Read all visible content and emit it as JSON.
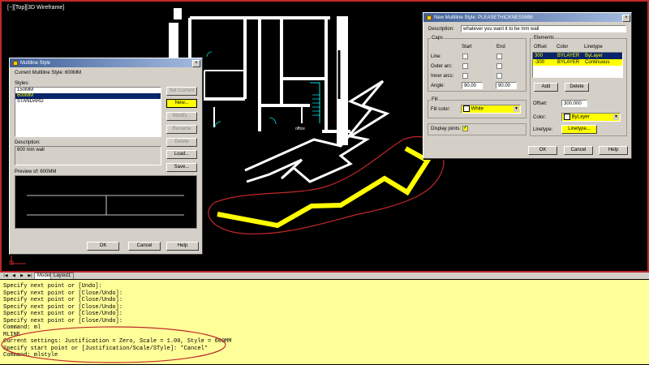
{
  "viewport": {
    "label": "[−][Top][3D Wireframe]",
    "room_label": "office"
  },
  "multiline_style": {
    "title": "Multiline Style",
    "current_style": "Current Multiline Style: 600MM",
    "styles_label": "Styles:",
    "styles": [
      "150MM",
      "600MM",
      "STANDARD"
    ],
    "selected_style": "600MM",
    "description_label": "Description:",
    "description": "600 mm wall",
    "preview_label": "Preview of: 600MM",
    "buttons": {
      "set_current": "Set Current",
      "new": "New...",
      "modify": "Modify...",
      "rename": "Rename",
      "delete": "Delete",
      "load": "Load...",
      "save": "Save...",
      "ok": "OK",
      "cancel": "Cancel",
      "help": "Help"
    }
  },
  "new_style": {
    "title": "New Multiline Style: PLEASETHICKNESSMM",
    "description_label": "Description:",
    "description": "whatever you want it to be  mm wall",
    "caps": {
      "label": "Caps",
      "start_label": "Start",
      "end_label": "End",
      "rows": [
        "Line:",
        "Outer arc:",
        "Inner arcs:"
      ],
      "angle_label": "Angle:",
      "angle_start": "90.00",
      "angle_end": "90.00"
    },
    "fill": {
      "label": "Fill",
      "color_label": "Fill color:",
      "color_value": "White"
    },
    "display_joints_label": "Display joints:",
    "elements": {
      "label": "Elements",
      "headers": [
        "Offset",
        "Color",
        "Linetype"
      ],
      "rows": [
        {
          "offset": "300",
          "color": "BYLAYER",
          "linetype": "ByLayer"
        },
        {
          "offset": "-300",
          "color": "BYLAYER",
          "linetype": "Continuous"
        }
      ],
      "add": "Add",
      "delete": "Delete",
      "offset_label": "Offset:",
      "offset_value": "300.000",
      "color_label": "Color:",
      "color_value": "ByLayer",
      "linetype_label": "Linetype:",
      "linetype_button": "Linetype..."
    },
    "buttons": {
      "ok": "OK",
      "cancel": "Cancel",
      "help": "Help"
    }
  },
  "tabs": {
    "model": "Model",
    "layout1": "Layout1"
  },
  "command_lines": [
    "Specify next point or [Undo]:",
    "Specify next point or [Close/Undo]:",
    "Specify next point or [Close/Undo]:",
    "Specify next point or [Close/Undo]:",
    "Specify next point or [Close/Undo]:",
    "Specify next point or [Close/Undo]:",
    "Command: ml",
    "MLINE",
    "Current settings: Justification = Zero, Scale = 1.00, Style = 600MM",
    "Specify start point or [Justification/Scale/STyle]:  *Cancel*",
    "Command: mlstyle"
  ],
  "colors": {
    "highlight": "#ffff00",
    "annotation": "#c0282a",
    "command_bg": "#ffff99"
  }
}
